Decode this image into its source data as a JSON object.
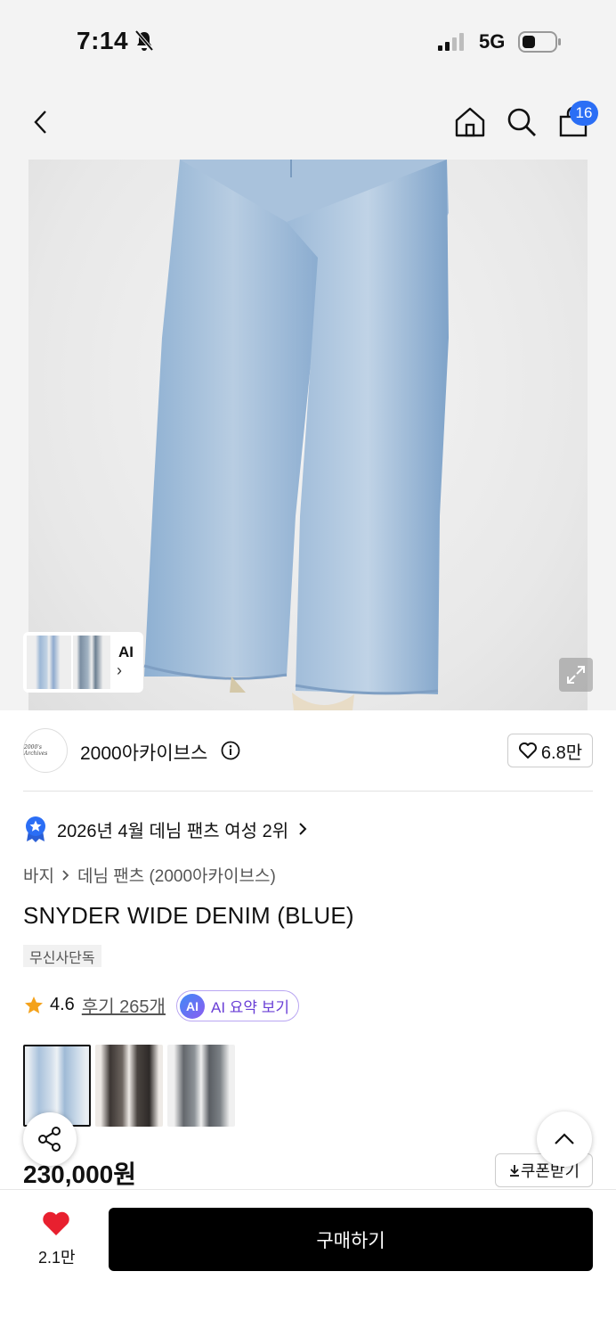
{
  "status_bar": {
    "time": "7:14",
    "network": "5G"
  },
  "nav": {
    "cart_count": "16"
  },
  "hero": {
    "ai_label": "AI",
    "ai_arrow": "›"
  },
  "brand": {
    "name": "2000아카이브스",
    "logo_text": "2000's Archives",
    "likes": "6.8만"
  },
  "ranking": {
    "text": "2026년 4월 데님 팬츠 여성 2위"
  },
  "breadcrumb": {
    "category": "바지",
    "subcategory": "데님 팬츠 (2000아카이브스)"
  },
  "product": {
    "title": "SNYDER WIDE DENIM (BLUE)",
    "tag": "무신사단독",
    "rating": "4.6",
    "reviews": "후기 265개",
    "ai_summary": "AI 요약 보기",
    "ai_badge": "AI",
    "price": "230,000원",
    "coupon": "쿠폰받기"
  },
  "color_options": [
    "blue",
    "black",
    "grey"
  ],
  "bottom_bar": {
    "wish_count": "2.1만",
    "buy_label": "구매하기"
  },
  "colors": {
    "accent_blue": "#2b6ef5",
    "star": "#f4a21b",
    "heart": "#e8202f",
    "ai_purple": "#6a3fd6"
  }
}
